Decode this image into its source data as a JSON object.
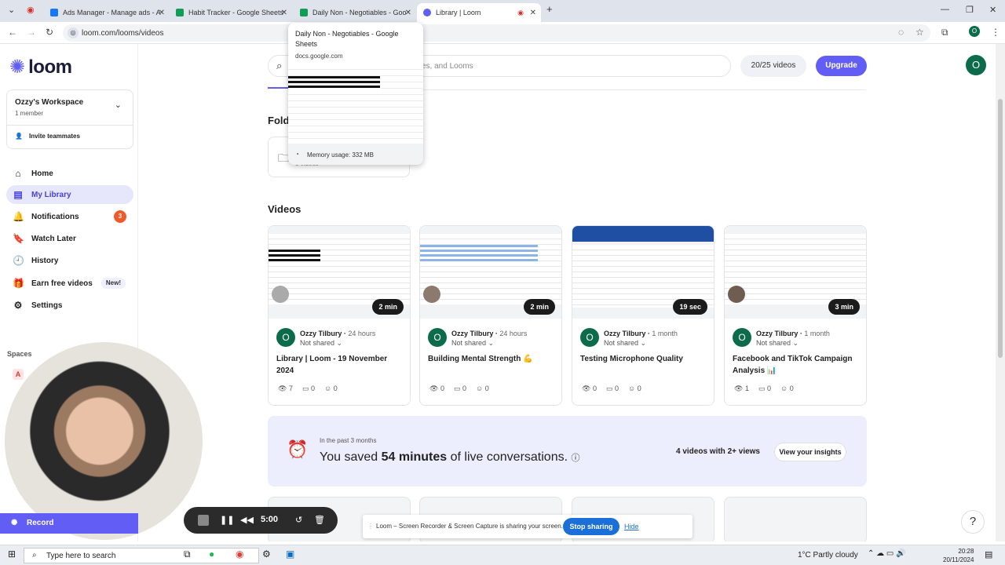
{
  "browser": {
    "tabs": [
      {
        "label": "Ads Manager - Manage ads - A",
        "color": "#1877f2"
      },
      {
        "label": "Habit Tracker - Google Sheets",
        "color": "#0f9d58"
      },
      {
        "label": "Daily Non - Negotiables - Goo",
        "color": "#0f9d58"
      },
      {
        "label": "Library | Loom",
        "color": "#625df5"
      }
    ],
    "url": "loom.com/looms/videos",
    "hover_card": {
      "title": "Daily Non - Negotiables - Google Sheets",
      "domain": "docs.google.com",
      "memory": "Memory usage: 332 MB"
    }
  },
  "sidebar": {
    "logo": "loom",
    "workspace": {
      "name": "Ozzy's Workspace",
      "members": "1 member",
      "invite": "Invite teammates"
    },
    "nav": [
      {
        "label": "Home",
        "icon": "home-icon",
        "glyph": "⌂"
      },
      {
        "label": "My Library",
        "icon": "library-icon",
        "glyph": "▤"
      },
      {
        "label": "Notifications",
        "icon": "bell-icon",
        "glyph": "🔔",
        "badge": "3"
      },
      {
        "label": "Watch Later",
        "icon": "bookmark-icon",
        "glyph": "🔖"
      },
      {
        "label": "History",
        "icon": "clock-icon",
        "glyph": "🕘"
      },
      {
        "label": "Earn free videos",
        "icon": "gift-icon",
        "glyph": "🎁",
        "pill": "New!"
      },
      {
        "label": "Settings",
        "icon": "gear-icon",
        "glyph": "⚙"
      }
    ],
    "spaces_label": "Spaces",
    "space_letter": "A",
    "record_label": "Record"
  },
  "header": {
    "search_placeholder": "ces, and Looms",
    "usage": "20/25 videos",
    "upgrade": "Upgrade",
    "avatar": "O"
  },
  "folders": {
    "title": "Fold",
    "count": "0 videos"
  },
  "videos": {
    "title": "Videos",
    "items": [
      {
        "author": "Ozzy Tilbury",
        "age": "24 hours",
        "share": "Not shared",
        "title": "Library | Loom - 19 November 2024",
        "duration": "2 min",
        "views": "7",
        "comments": "0",
        "reactions": "0"
      },
      {
        "author": "Ozzy Tilbury",
        "age": "24 hours",
        "share": "Not shared",
        "title": "Building Mental Strength 💪",
        "duration": "2 min",
        "views": "0",
        "comments": "0",
        "reactions": "0"
      },
      {
        "author": "Ozzy Tilbury",
        "age": "1 month",
        "share": "Not shared",
        "title": "Testing Microphone Quality",
        "duration": "19 sec",
        "views": "0",
        "comments": "0",
        "reactions": "0"
      },
      {
        "author": "Ozzy Tilbury",
        "age": "1 month",
        "share": "Not shared",
        "title": "Facebook and TikTok Campaign Analysis 📊",
        "duration": "3 min",
        "views": "1",
        "comments": "0",
        "reactions": "0"
      }
    ]
  },
  "insights": {
    "period": "In the past 3 months",
    "saved_pre": "You saved ",
    "saved_value": "54 minutes",
    "saved_post": " of live conversations.",
    "views": "4 videos with 2+ views",
    "button": "View your insights"
  },
  "recorder": {
    "time": "5:00"
  },
  "share_bar": {
    "text": "Loom – Screen Recorder & Screen Capture is sharing your screen.",
    "stop": "Stop sharing",
    "hide": "Hide"
  },
  "taskbar": {
    "search": "Type here to search",
    "weather": "1°C  Partly cloudy",
    "time": "20:28",
    "date": "20/11/2024"
  }
}
